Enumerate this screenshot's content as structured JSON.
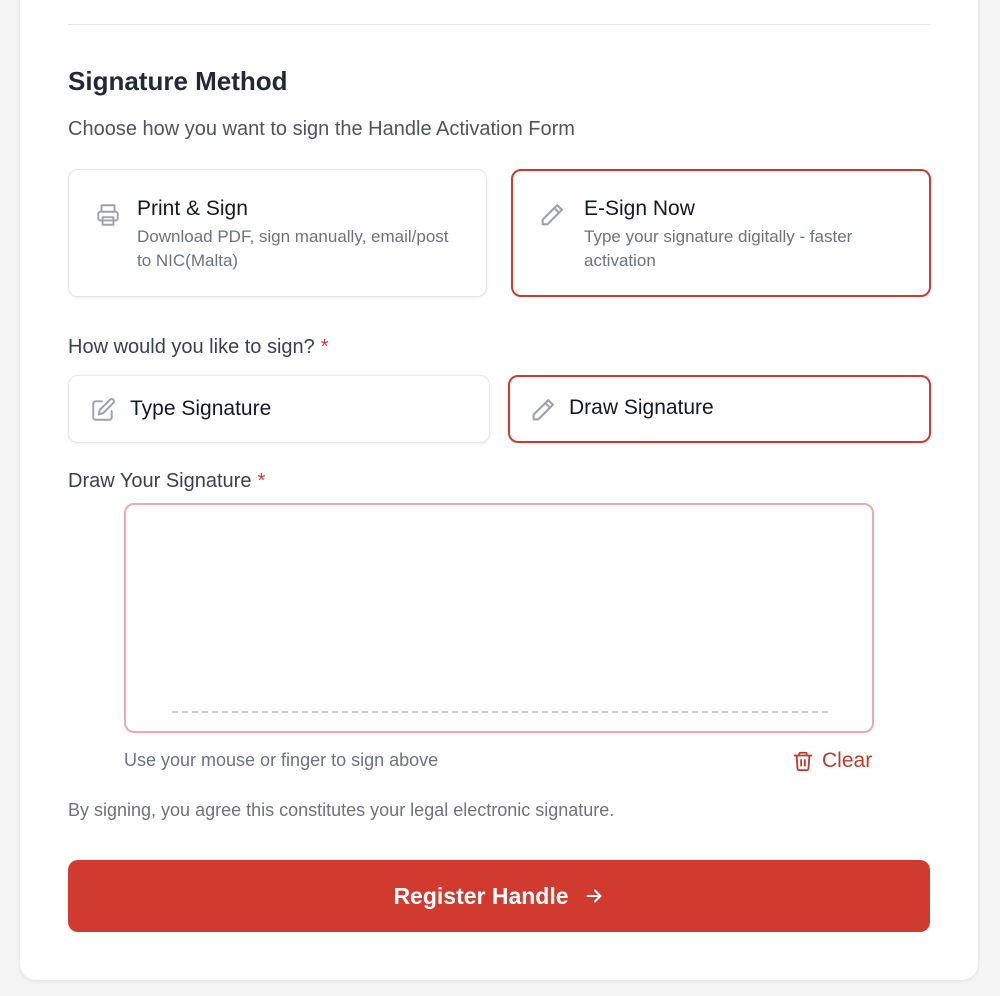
{
  "section": {
    "title": "Signature Method",
    "subtitle": "Choose how you want to sign the Handle Activation Form"
  },
  "methods": [
    {
      "title": "Print & Sign",
      "description": "Download PDF, sign manually, email/post to NIC(Malta)",
      "icon": "printer-icon",
      "selected": false
    },
    {
      "title": "E-Sign Now",
      "description": "Type your signature digitally - faster activation",
      "icon": "pencil-icon",
      "selected": true
    }
  ],
  "sign_question": {
    "label": "How would you like to sign?",
    "required_mark": "*"
  },
  "sign_options": [
    {
      "label": "Type Signature",
      "icon": "edit-square-icon",
      "selected": false
    },
    {
      "label": "Draw Signature",
      "icon": "pencil-icon",
      "selected": true
    }
  ],
  "draw_pad": {
    "label": "Draw Your Signature",
    "required_mark": "*",
    "hint": "Use your mouse or finger to sign above",
    "clear_label": "Clear"
  },
  "legal_text": "By signing, you agree this constitutes your legal electronic signature.",
  "submit_label": "Register Handle",
  "colors": {
    "accent": "#d03a2f",
    "pad_border": "#f0a8a8",
    "muted_text": "#6b7280"
  }
}
